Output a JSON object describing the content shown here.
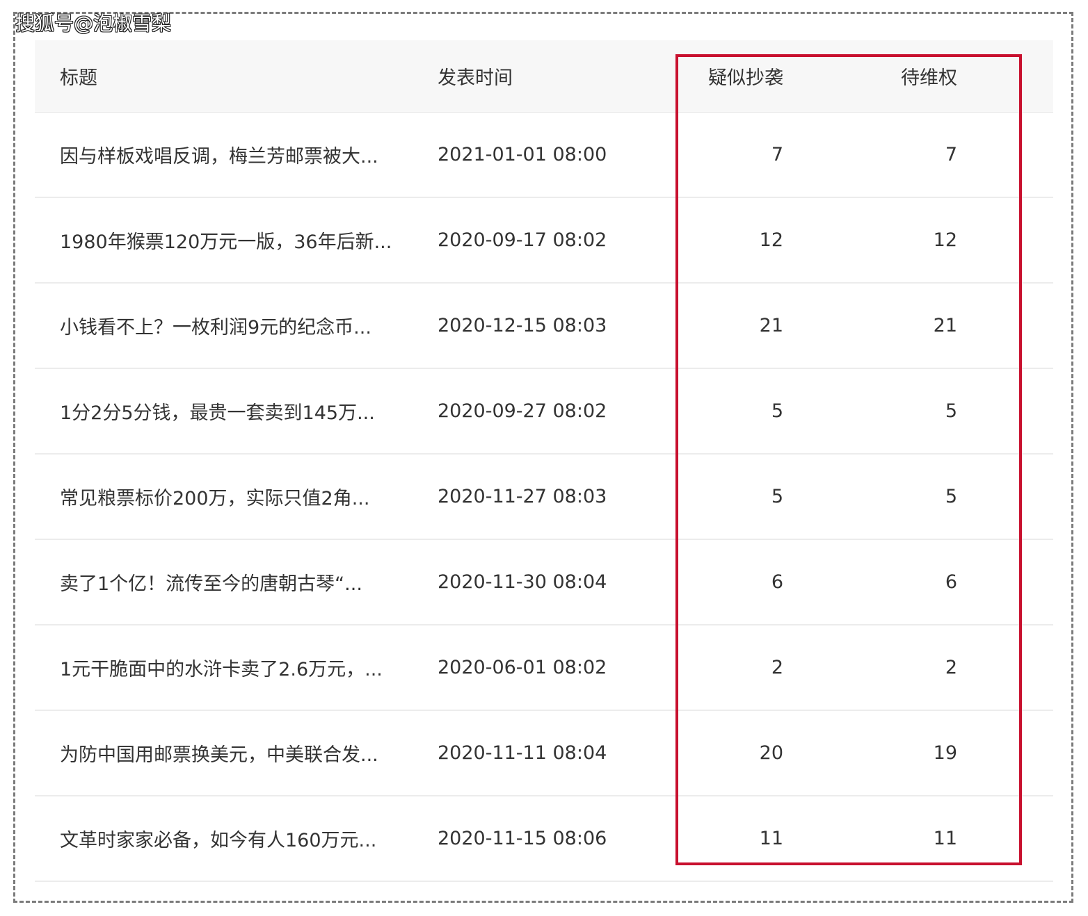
{
  "watermark": "搜狐号@泡椒雪梨",
  "highlight_color": "#c8102e",
  "table": {
    "headers": {
      "title": "标题",
      "time": "发表时间",
      "suspected": "疑似抄袭",
      "pending": "待维权"
    },
    "rows": [
      {
        "title": "因与样板戏唱反调，梅兰芳邮票被大...",
        "time": "2021-01-01 08:00",
        "suspected": "7",
        "pending": "7"
      },
      {
        "title": "1980年猴票120万元一版，36年后新...",
        "time": "2020-09-17 08:02",
        "suspected": "12",
        "pending": "12"
      },
      {
        "title": "小钱看不上？一枚利润9元的纪念币...",
        "time": "2020-12-15 08:03",
        "suspected": "21",
        "pending": "21"
      },
      {
        "title": "1分2分5分钱，最贵一套卖到145万...",
        "time": "2020-09-27 08:02",
        "suspected": "5",
        "pending": "5"
      },
      {
        "title": "常见粮票标价200万，实际只值2角...",
        "time": "2020-11-27 08:03",
        "suspected": "5",
        "pending": "5"
      },
      {
        "title": "卖了1个亿！流传至今的唐朝古琴“...",
        "time": "2020-11-30 08:04",
        "suspected": "6",
        "pending": "6"
      },
      {
        "title": "1元干脆面中的水浒卡卖了2.6万元，...",
        "time": "2020-06-01 08:02",
        "suspected": "2",
        "pending": "2"
      },
      {
        "title": "为防中国用邮票换美元，中美联合发...",
        "time": "2020-11-11 08:04",
        "suspected": "20",
        "pending": "19"
      },
      {
        "title": "文革时家家必备，如今有人160万元...",
        "time": "2020-11-15 08:06",
        "suspected": "11",
        "pending": "11"
      }
    ]
  }
}
